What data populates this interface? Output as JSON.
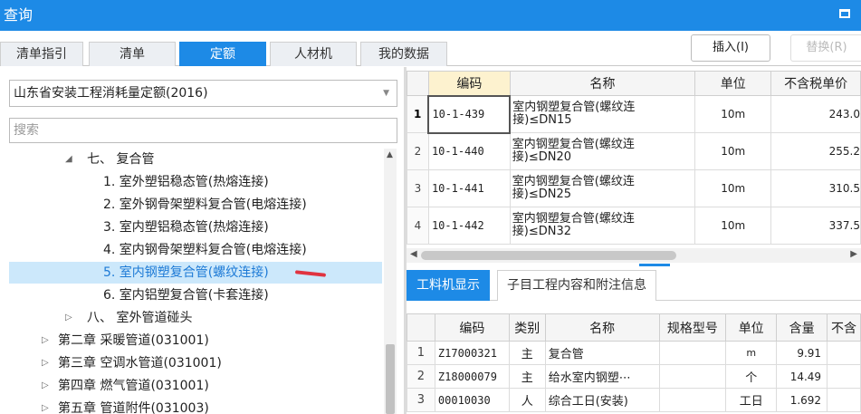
{
  "window": {
    "title": "查询"
  },
  "tabs": [
    {
      "label": "清单指引"
    },
    {
      "label": "清单"
    },
    {
      "label": "定额"
    },
    {
      "label": "人材机"
    },
    {
      "label": "我的数据"
    }
  ],
  "toolbar": {
    "insert_label": "插入(I)",
    "replace_label": "替换(R)"
  },
  "left": {
    "library_select": "山东省安装工程消耗量定额(2016)",
    "search_placeholder": "搜索",
    "tree": [
      {
        "label": "七、 复合管",
        "expanded": true
      },
      {
        "label": "1. 室外塑铝稳态管(热熔连接)"
      },
      {
        "label": "2. 室外钢骨架塑料复合管(电熔连接)"
      },
      {
        "label": "3. 室内塑铝稳态管(热熔连接)"
      },
      {
        "label": "4. 室内钢骨架塑料复合管(电熔连接)"
      },
      {
        "label": "5. 室内钢塑复合管(螺纹连接)",
        "selected": true
      },
      {
        "label": "6. 室内铝塑复合管(卡套连接)"
      },
      {
        "label": "八、 室外管道碰头",
        "expanded": false
      },
      {
        "label": "第二章 采暖管道(031001)",
        "expanded": false
      },
      {
        "label": "第三章 空调水管道(031001)",
        "expanded": false
      },
      {
        "label": "第四章 燃气管道(031001)",
        "expanded": false
      },
      {
        "label": "第五章 管道附件(031003)",
        "expanded": false
      }
    ]
  },
  "quota_grid": {
    "headers": {
      "code": "编码",
      "name": "名称",
      "unit": "单位",
      "price": "不含税单价"
    },
    "rows": [
      {
        "no": "1",
        "code": "10-1-439",
        "name_l1": "室内钢塑复合管(螺纹连",
        "name_l2": "接)≤DN15",
        "unit": "10m",
        "price": "243.0"
      },
      {
        "no": "2",
        "code": "10-1-440",
        "name_l1": "室内钢塑复合管(螺纹连",
        "name_l2": "接)≤DN20",
        "unit": "10m",
        "price": "255.2"
      },
      {
        "no": "3",
        "code": "10-1-441",
        "name_l1": "室内钢塑复合管(螺纹连",
        "name_l2": "接)≤DN25",
        "unit": "10m",
        "price": "310.5"
      },
      {
        "no": "4",
        "code": "10-1-442",
        "name_l1": "室内钢塑复合管(螺纹连",
        "name_l2": "接)≤DN32",
        "unit": "10m",
        "price": "337.5"
      }
    ]
  },
  "sub_tabs": [
    {
      "label": "工料机显示"
    },
    {
      "label": "子目工程内容和附注信息"
    }
  ],
  "resource_grid": {
    "headers": {
      "code": "编码",
      "type": "类别",
      "name": "名称",
      "spec": "规格型号",
      "unit": "单位",
      "qty": "含量",
      "extra": "不含"
    },
    "rows": [
      {
        "no": "1",
        "code": "Z17000321",
        "type": "主",
        "name": "复合管",
        "spec": "",
        "unit": "m",
        "qty": "9.91"
      },
      {
        "no": "2",
        "code": "Z18000079",
        "type": "主",
        "name": "给水室内钢塑⋯",
        "spec": "",
        "unit": "个",
        "qty": "14.49"
      },
      {
        "no": "3",
        "code": "00010030",
        "type": "人",
        "name": "综合工日(安装)",
        "spec": "",
        "unit": "工日",
        "qty": "1.692"
      }
    ]
  }
}
